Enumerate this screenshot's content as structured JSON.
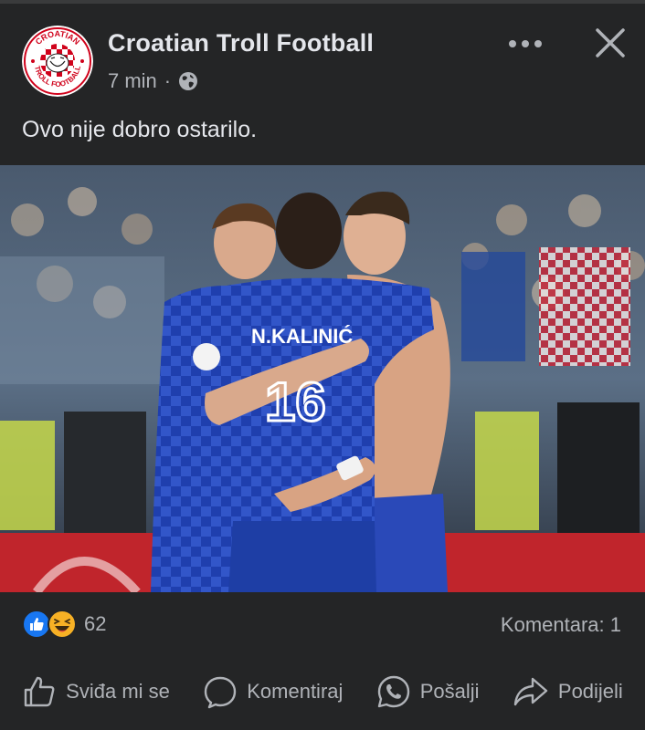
{
  "post": {
    "page_name": "Croatian Troll Football",
    "time": "7 min",
    "separator": "·",
    "text": "Ovo nije dobro ostarilo.",
    "avatar_logo_text": "CROATIAN TROLL FOOTBALL",
    "image_jersey_text": "N.KALINIĆ",
    "image_jersey_number": "16"
  },
  "reactions": {
    "count": "62",
    "types": [
      "like-icon",
      "haha-icon"
    ],
    "like_color": "#1877f2",
    "haha_color": "#f7b125"
  },
  "comments": {
    "label": "Komentara: 1"
  },
  "actions": {
    "like": "Sviđa mi se",
    "comment": "Komentiraj",
    "send": "Pošalji",
    "share": "Podijeli"
  },
  "colors": {
    "background": "#242526",
    "text_primary": "#e4e6eb",
    "text_secondary": "#b0b3b8"
  }
}
